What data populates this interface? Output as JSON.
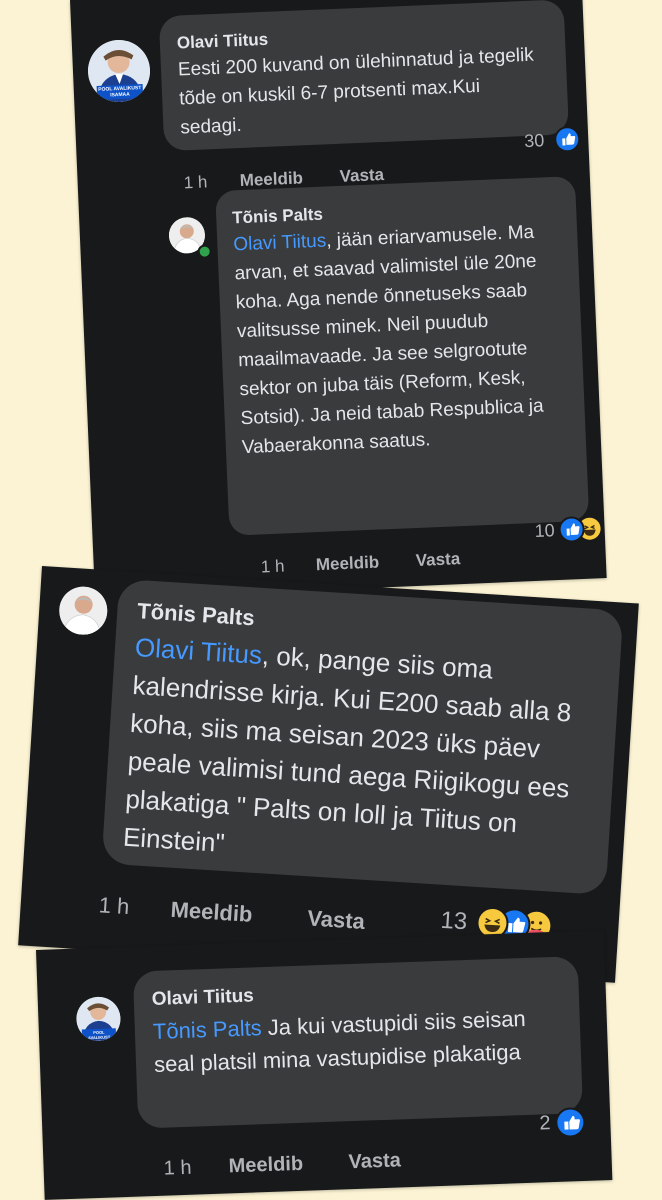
{
  "comment1": {
    "author": "Olavi Tiitus",
    "avatar_caption": "POOL AVALIKUST ISAMAA",
    "text": "Eesti 200 kuvand on ülehinnatud ja tegelik tõde on kuskil 6-7 protsenti max.Kui sedagi.",
    "time": "1 h",
    "like_label": "Meeldib",
    "reply_label": "Vasta",
    "reaction_count": "30",
    "reactions": [
      "like-icon"
    ]
  },
  "comment2": {
    "author": "Tõnis Palts",
    "mention": "Olavi Tiitus",
    "text": ", jään eriarvamusele. Ma arvan, et saavad valimistel üle 20ne koha. Aga nende õnnetuseks saab valitsusse minek. Neil puudub maailmavaade. Ja see selgrootute sektor on juba täis (Reform, Kesk, Sotsid). Ja neid tabab Respublica ja Vabaerakonna saatus.",
    "time": "1 h",
    "like_label": "Meeldib",
    "reply_label": "Vasta",
    "reaction_count": "10",
    "reactions": [
      "like-icon",
      "haha-icon"
    ]
  },
  "comment3": {
    "author": "Tõnis Palts",
    "mention": "Olavi Tiitus",
    "text": ", ok, pange siis oma kalendrisse kirja. Kui E200 saab alla 8 koha, siis ma seisan 2023 üks päev peale valimisi tund aega Riigikogu ees plakatiga \" Palts on loll ja Tiitus on Einstein\"",
    "time": "1 h",
    "like_label": "Meeldib",
    "reply_label": "Vasta",
    "reaction_count": "13",
    "reactions": [
      "haha-icon",
      "like-icon",
      "care-icon"
    ]
  },
  "comment4": {
    "author": "Olavi Tiitus",
    "avatar_caption": "POOL AVALIKUST ISAMAA",
    "mention": "Tõnis Palts",
    "text": " Ja kui vastupidi siis seisan seal platsil mina vastupidise plakatiga",
    "time": "1 h",
    "like_label": "Meeldib",
    "reply_label": "Vasta",
    "reaction_count": "2",
    "reactions": [
      "like-icon"
    ]
  },
  "colors": {
    "page_background": "#fbf3d3",
    "card_background": "#18191a",
    "bubble_background": "#3a3b3c",
    "text": "#e4e6eb",
    "meta_text": "#b0b3b8",
    "mention": "#4599ff",
    "like_blue": "#1877f2",
    "haha_yellow": "#f7c93e",
    "online_green": "#31a24c"
  }
}
